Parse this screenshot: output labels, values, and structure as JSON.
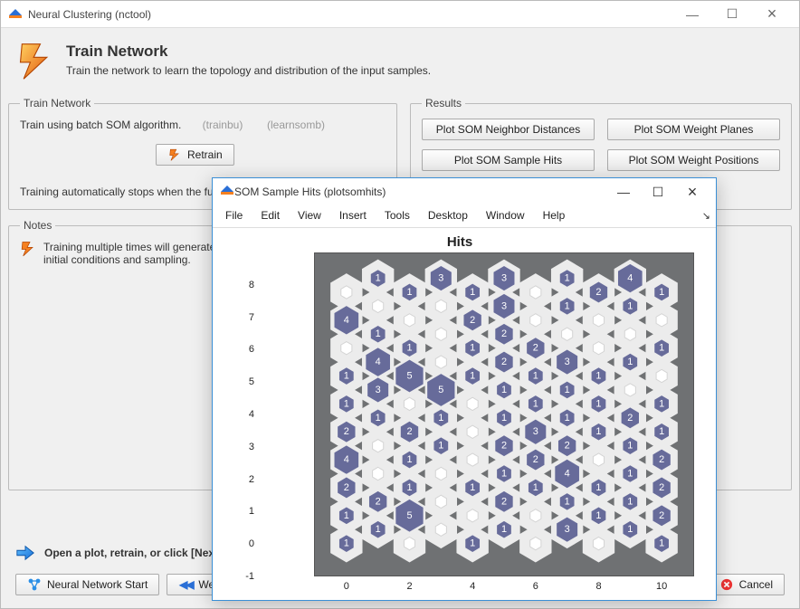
{
  "main_window": {
    "title": "Neural Clustering (nctool)"
  },
  "header": {
    "title": "Train Network",
    "subtitle": "Train the network to learn the topology and distribution of the input samples."
  },
  "train_panel": {
    "legend": "Train Network",
    "algo_text": "Train using batch SOM algorithm.",
    "algo_paren1": "(trainbu)",
    "algo_paren2": "(learnsomb)",
    "retrain_label": "Retrain",
    "auto_stop": "Training automatically stops when the full number of epochs have occurred."
  },
  "results_panel": {
    "legend": "Results",
    "btn_neighbor": "Plot SOM Neighbor Distances",
    "btn_weightplanes": "Plot SOM Weight Planes",
    "btn_samplehits": "Plot SOM Sample Hits",
    "btn_weightpos": "Plot SOM Weight Positions"
  },
  "notes_panel": {
    "legend": "Notes",
    "note1": "Training multiple times will generate different results due to different initial conditions and sampling."
  },
  "guidance": {
    "text": "Open a plot, retrain, or click [Next] to continue."
  },
  "bottom_bar": {
    "nn_start": "Neural Network Start",
    "welcome": "Welcome",
    "cancel": "Cancel"
  },
  "sub_window": {
    "title": "SOM Sample Hits (plotsomhits)",
    "menu": [
      "File",
      "Edit",
      "View",
      "Insert",
      "Tools",
      "Desktop",
      "Window",
      "Help"
    ],
    "plot_title": "Hits",
    "x_ticks": [
      0,
      2,
      4,
      6,
      8,
      10
    ],
    "y_ticks": [
      -1,
      0,
      1,
      2,
      3,
      4,
      5,
      6,
      7,
      8
    ]
  },
  "chart_data": {
    "type": "heatmap",
    "title": "Hits",
    "xlabel": "",
    "ylabel": "",
    "xlim": [
      -1,
      11
    ],
    "ylim": [
      -1,
      9
    ],
    "grid": "10x10 hexagonal SOM topology, column offset on odd columns",
    "rows": [
      [
        1,
        1,
        0,
        0,
        1,
        1,
        0,
        3,
        0,
        1,
        1
      ],
      [
        1,
        2,
        5,
        0,
        0,
        2,
        0,
        1,
        1,
        1,
        2
      ],
      [
        2,
        0,
        1,
        0,
        1,
        1,
        1,
        4,
        1,
        1,
        2
      ],
      [
        4,
        0,
        1,
        1,
        0,
        2,
        2,
        2,
        0,
        1,
        2
      ],
      [
        2,
        1,
        2,
        1,
        0,
        1,
        3,
        1,
        1,
        2,
        1
      ],
      [
        1,
        3,
        0,
        5,
        0,
        1,
        1,
        1,
        1,
        0,
        1
      ],
      [
        1,
        4,
        5,
        0,
        1,
        2,
        1,
        3,
        1,
        1,
        0
      ],
      [
        0,
        1,
        1,
        0,
        1,
        2,
        2,
        0,
        0,
        0,
        1
      ],
      [
        4,
        0,
        0,
        0,
        2,
        3,
        0,
        1,
        0,
        1,
        0
      ],
      [
        0,
        1,
        1,
        3,
        1,
        3,
        0,
        1,
        2,
        4,
        1
      ]
    ],
    "max_value": 5,
    "note": "rows[0] is bottom row (y=0); each cell is hit count, 0 means empty/white small hex"
  }
}
